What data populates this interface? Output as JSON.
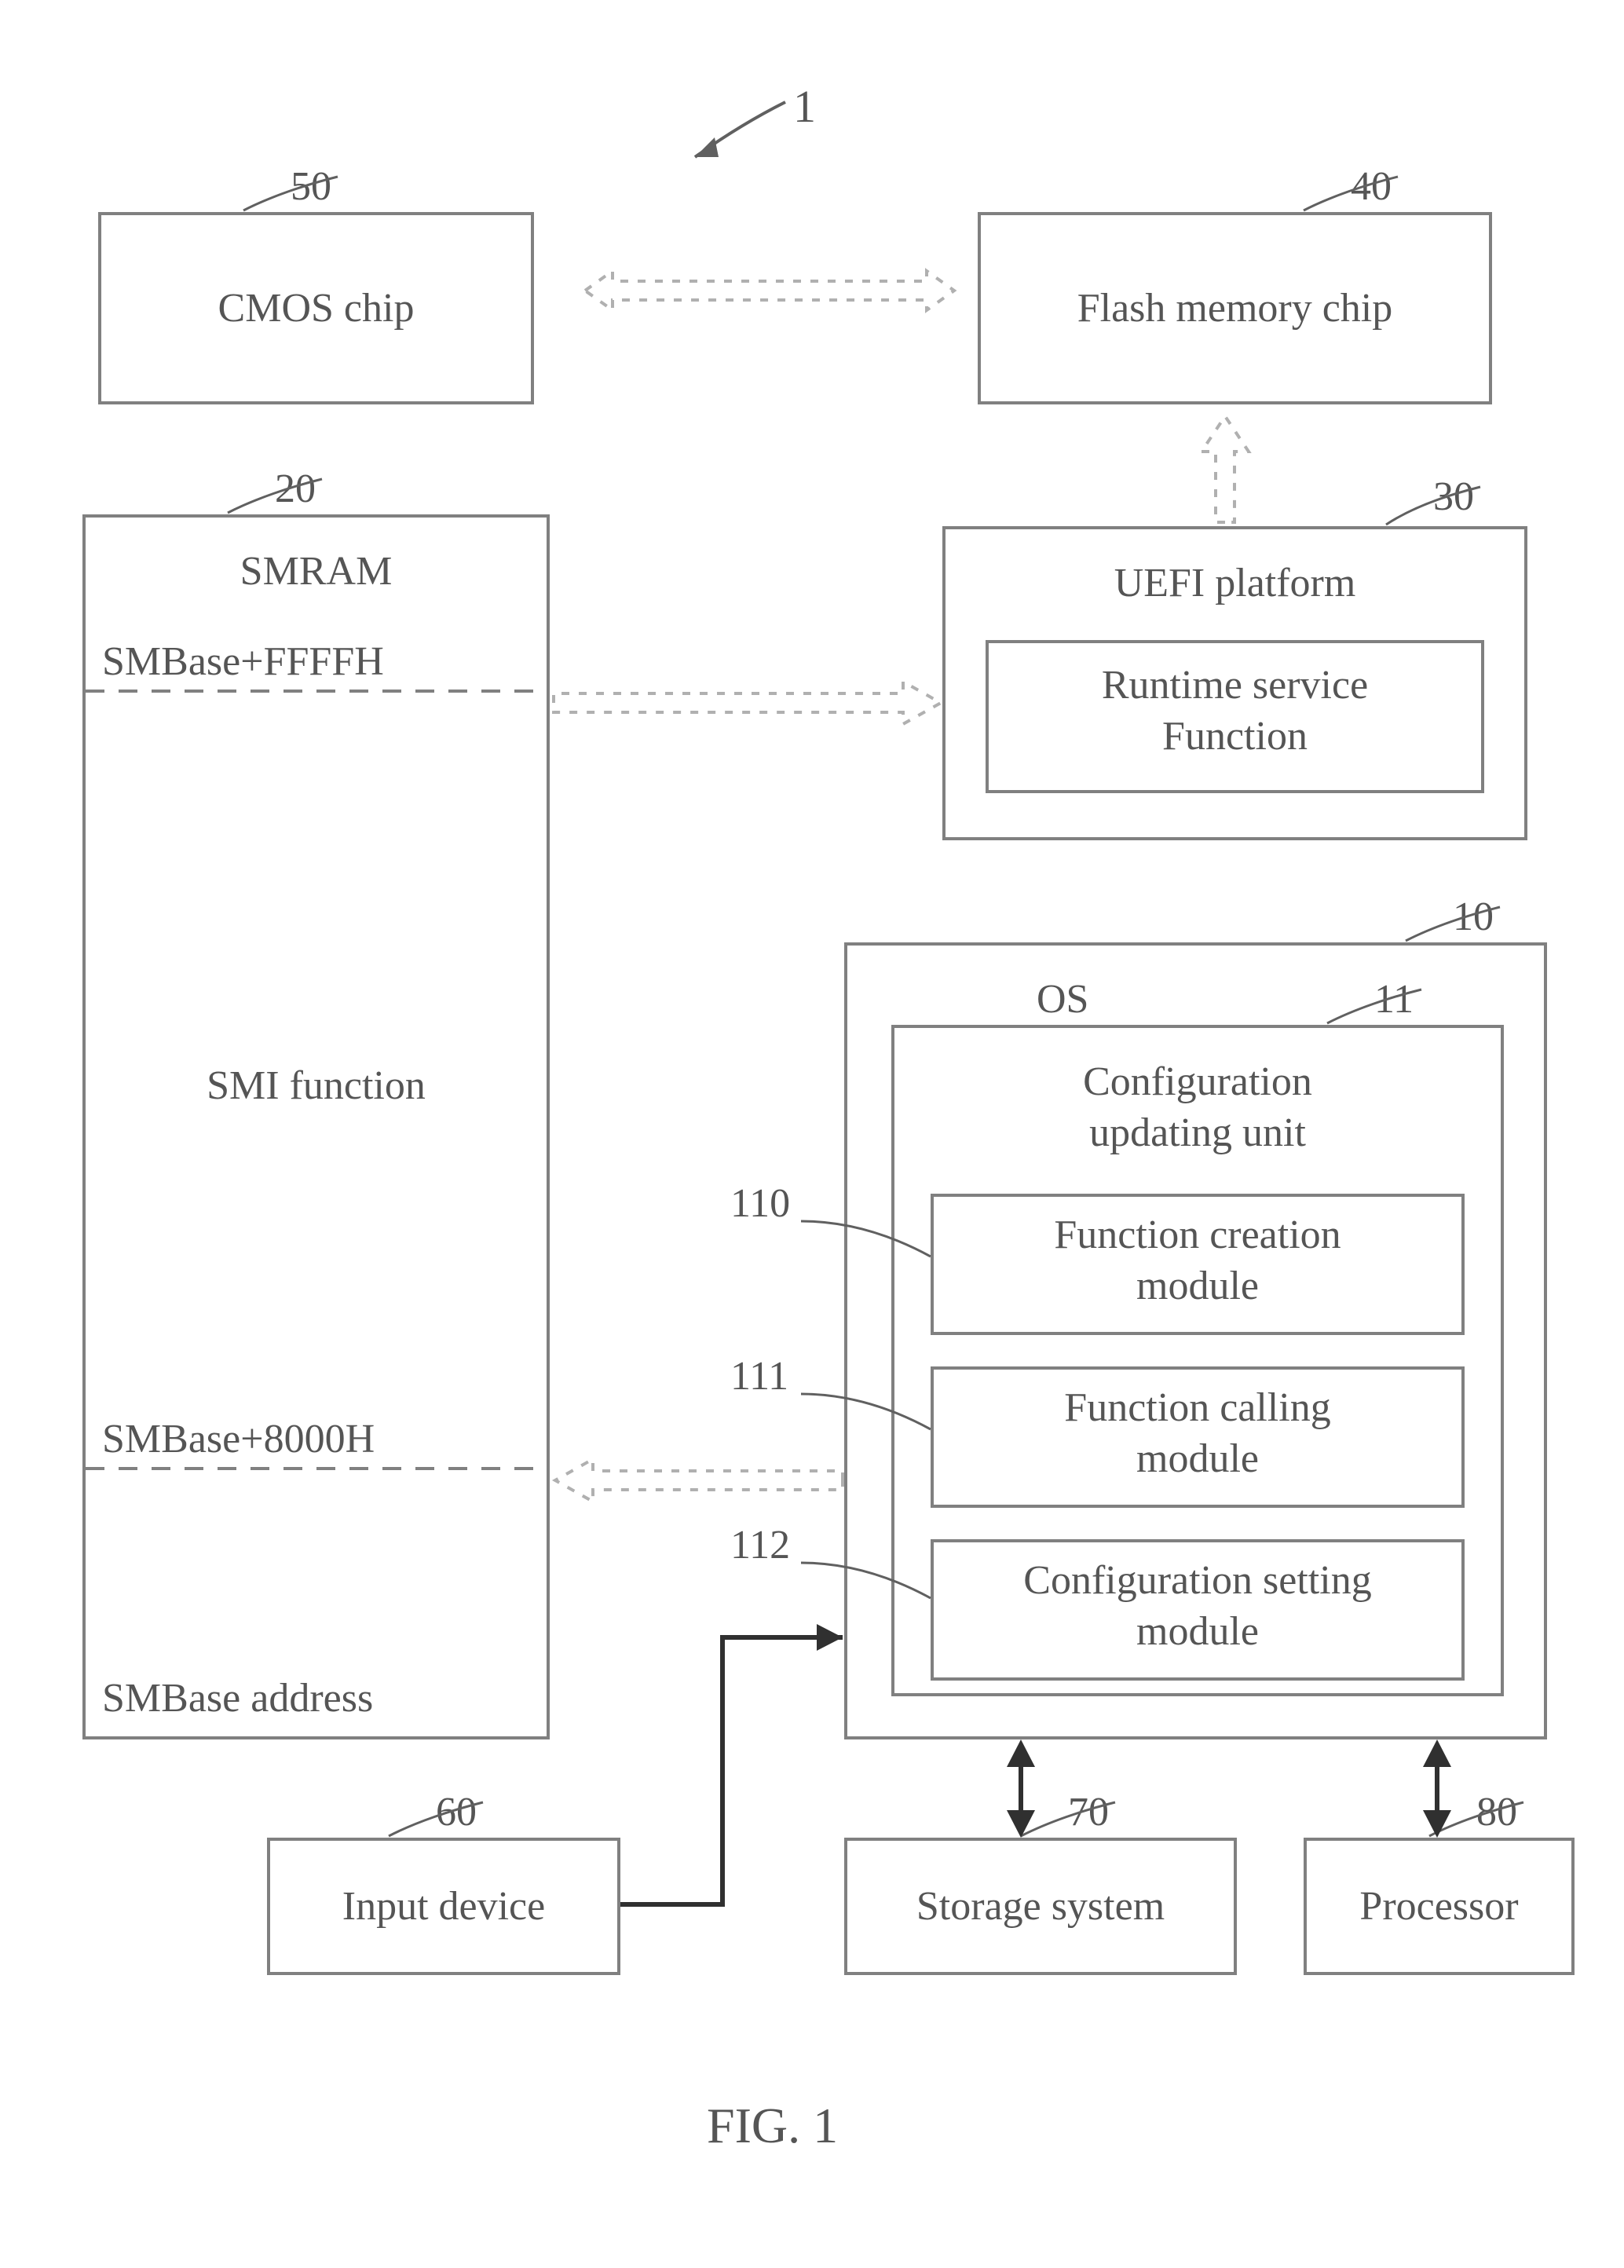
{
  "figure_label": "FIG. 1",
  "main_ref": "1",
  "blocks": {
    "cmos": {
      "ref": "50",
      "title": "CMOS chip"
    },
    "flash": {
      "ref": "40",
      "title": "Flash memory chip"
    },
    "smram": {
      "ref": "20",
      "title": "SMRAM",
      "lines": {
        "top": "SMBase+FFFFH",
        "mid": "SMI function",
        "low": "SMBase+8000H",
        "base": "SMBase address"
      }
    },
    "uefi": {
      "ref": "30",
      "title": "UEFI platform",
      "inner": "Runtime service\nFunction"
    },
    "os": {
      "ref": "10",
      "title": "OS"
    },
    "cfg_unit": {
      "ref": "11",
      "title": "Configuration\nupdating unit"
    },
    "mod_create": {
      "ref": "110",
      "title": "Function creation\nmodule"
    },
    "mod_call": {
      "ref": "111",
      "title": "Function calling\nmodule"
    },
    "mod_set": {
      "ref": "112",
      "title": "Configuration setting\nmodule"
    },
    "input": {
      "ref": "60",
      "title": "Input device"
    },
    "storage": {
      "ref": "70",
      "title": "Storage system"
    },
    "processor": {
      "ref": "80",
      "title": "Processor"
    }
  }
}
